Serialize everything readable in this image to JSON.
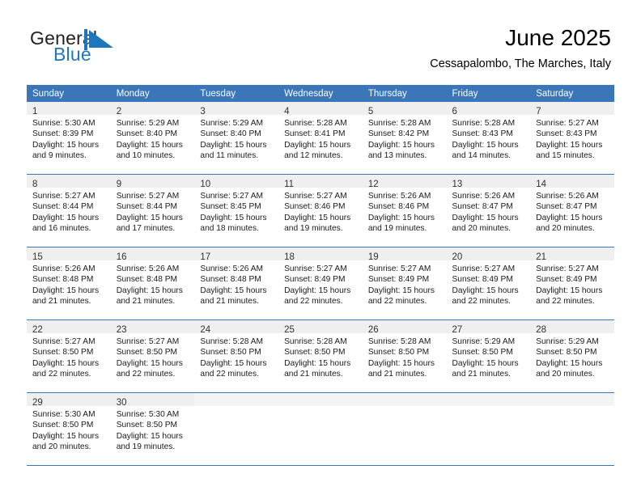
{
  "brand": {
    "word_top": "General",
    "word_bottom": "Blue",
    "mark_icon": "blue-triangle-flag-icon",
    "accent_color": "#1e76bd"
  },
  "header": {
    "title": "June 2025",
    "subtitle": "Cessapalombo, The Marches, Italy"
  },
  "theme": {
    "header_row_bg": "#3a76b8",
    "header_row_text": "#ffffff",
    "daynum_strip_bg": "#efefef",
    "cell_border": "#3a76b8"
  },
  "weekday_headers": [
    "Sunday",
    "Monday",
    "Tuesday",
    "Wednesday",
    "Thursday",
    "Friday",
    "Saturday"
  ],
  "labels": {
    "sunrise_prefix": "Sunrise:",
    "sunset_prefix": "Sunset:",
    "daylight_prefix": "Daylight:"
  },
  "weeks": [
    [
      {
        "day": "1",
        "sunrise": "Sunrise: 5:30 AM",
        "sunset": "Sunset: 8:39 PM",
        "daylight_1": "Daylight: 15 hours",
        "daylight_2": "and 9 minutes."
      },
      {
        "day": "2",
        "sunrise": "Sunrise: 5:29 AM",
        "sunset": "Sunset: 8:40 PM",
        "daylight_1": "Daylight: 15 hours",
        "daylight_2": "and 10 minutes."
      },
      {
        "day": "3",
        "sunrise": "Sunrise: 5:29 AM",
        "sunset": "Sunset: 8:40 PM",
        "daylight_1": "Daylight: 15 hours",
        "daylight_2": "and 11 minutes."
      },
      {
        "day": "4",
        "sunrise": "Sunrise: 5:28 AM",
        "sunset": "Sunset: 8:41 PM",
        "daylight_1": "Daylight: 15 hours",
        "daylight_2": "and 12 minutes."
      },
      {
        "day": "5",
        "sunrise": "Sunrise: 5:28 AM",
        "sunset": "Sunset: 8:42 PM",
        "daylight_1": "Daylight: 15 hours",
        "daylight_2": "and 13 minutes."
      },
      {
        "day": "6",
        "sunrise": "Sunrise: 5:28 AM",
        "sunset": "Sunset: 8:43 PM",
        "daylight_1": "Daylight: 15 hours",
        "daylight_2": "and 14 minutes."
      },
      {
        "day": "7",
        "sunrise": "Sunrise: 5:27 AM",
        "sunset": "Sunset: 8:43 PM",
        "daylight_1": "Daylight: 15 hours",
        "daylight_2": "and 15 minutes."
      }
    ],
    [
      {
        "day": "8",
        "sunrise": "Sunrise: 5:27 AM",
        "sunset": "Sunset: 8:44 PM",
        "daylight_1": "Daylight: 15 hours",
        "daylight_2": "and 16 minutes."
      },
      {
        "day": "9",
        "sunrise": "Sunrise: 5:27 AM",
        "sunset": "Sunset: 8:44 PM",
        "daylight_1": "Daylight: 15 hours",
        "daylight_2": "and 17 minutes."
      },
      {
        "day": "10",
        "sunrise": "Sunrise: 5:27 AM",
        "sunset": "Sunset: 8:45 PM",
        "daylight_1": "Daylight: 15 hours",
        "daylight_2": "and 18 minutes."
      },
      {
        "day": "11",
        "sunrise": "Sunrise: 5:27 AM",
        "sunset": "Sunset: 8:46 PM",
        "daylight_1": "Daylight: 15 hours",
        "daylight_2": "and 19 minutes."
      },
      {
        "day": "12",
        "sunrise": "Sunrise: 5:26 AM",
        "sunset": "Sunset: 8:46 PM",
        "daylight_1": "Daylight: 15 hours",
        "daylight_2": "and 19 minutes."
      },
      {
        "day": "13",
        "sunrise": "Sunrise: 5:26 AM",
        "sunset": "Sunset: 8:47 PM",
        "daylight_1": "Daylight: 15 hours",
        "daylight_2": "and 20 minutes."
      },
      {
        "day": "14",
        "sunrise": "Sunrise: 5:26 AM",
        "sunset": "Sunset: 8:47 PM",
        "daylight_1": "Daylight: 15 hours",
        "daylight_2": "and 20 minutes."
      }
    ],
    [
      {
        "day": "15",
        "sunrise": "Sunrise: 5:26 AM",
        "sunset": "Sunset: 8:48 PM",
        "daylight_1": "Daylight: 15 hours",
        "daylight_2": "and 21 minutes."
      },
      {
        "day": "16",
        "sunrise": "Sunrise: 5:26 AM",
        "sunset": "Sunset: 8:48 PM",
        "daylight_1": "Daylight: 15 hours",
        "daylight_2": "and 21 minutes."
      },
      {
        "day": "17",
        "sunrise": "Sunrise: 5:26 AM",
        "sunset": "Sunset: 8:48 PM",
        "daylight_1": "Daylight: 15 hours",
        "daylight_2": "and 21 minutes."
      },
      {
        "day": "18",
        "sunrise": "Sunrise: 5:27 AM",
        "sunset": "Sunset: 8:49 PM",
        "daylight_1": "Daylight: 15 hours",
        "daylight_2": "and 22 minutes."
      },
      {
        "day": "19",
        "sunrise": "Sunrise: 5:27 AM",
        "sunset": "Sunset: 8:49 PM",
        "daylight_1": "Daylight: 15 hours",
        "daylight_2": "and 22 minutes."
      },
      {
        "day": "20",
        "sunrise": "Sunrise: 5:27 AM",
        "sunset": "Sunset: 8:49 PM",
        "daylight_1": "Daylight: 15 hours",
        "daylight_2": "and 22 minutes."
      },
      {
        "day": "21",
        "sunrise": "Sunrise: 5:27 AM",
        "sunset": "Sunset: 8:49 PM",
        "daylight_1": "Daylight: 15 hours",
        "daylight_2": "and 22 minutes."
      }
    ],
    [
      {
        "day": "22",
        "sunrise": "Sunrise: 5:27 AM",
        "sunset": "Sunset: 8:50 PM",
        "daylight_1": "Daylight: 15 hours",
        "daylight_2": "and 22 minutes."
      },
      {
        "day": "23",
        "sunrise": "Sunrise: 5:27 AM",
        "sunset": "Sunset: 8:50 PM",
        "daylight_1": "Daylight: 15 hours",
        "daylight_2": "and 22 minutes."
      },
      {
        "day": "24",
        "sunrise": "Sunrise: 5:28 AM",
        "sunset": "Sunset: 8:50 PM",
        "daylight_1": "Daylight: 15 hours",
        "daylight_2": "and 22 minutes."
      },
      {
        "day": "25",
        "sunrise": "Sunrise: 5:28 AM",
        "sunset": "Sunset: 8:50 PM",
        "daylight_1": "Daylight: 15 hours",
        "daylight_2": "and 21 minutes."
      },
      {
        "day": "26",
        "sunrise": "Sunrise: 5:28 AM",
        "sunset": "Sunset: 8:50 PM",
        "daylight_1": "Daylight: 15 hours",
        "daylight_2": "and 21 minutes."
      },
      {
        "day": "27",
        "sunrise": "Sunrise: 5:29 AM",
        "sunset": "Sunset: 8:50 PM",
        "daylight_1": "Daylight: 15 hours",
        "daylight_2": "and 21 minutes."
      },
      {
        "day": "28",
        "sunrise": "Sunrise: 5:29 AM",
        "sunset": "Sunset: 8:50 PM",
        "daylight_1": "Daylight: 15 hours",
        "daylight_2": "and 20 minutes."
      }
    ],
    [
      {
        "day": "29",
        "sunrise": "Sunrise: 5:30 AM",
        "sunset": "Sunset: 8:50 PM",
        "daylight_1": "Daylight: 15 hours",
        "daylight_2": "and 20 minutes."
      },
      {
        "day": "30",
        "sunrise": "Sunrise: 5:30 AM",
        "sunset": "Sunset: 8:50 PM",
        "daylight_1": "Daylight: 15 hours",
        "daylight_2": "and 19 minutes."
      },
      null,
      null,
      null,
      null,
      null
    ]
  ]
}
